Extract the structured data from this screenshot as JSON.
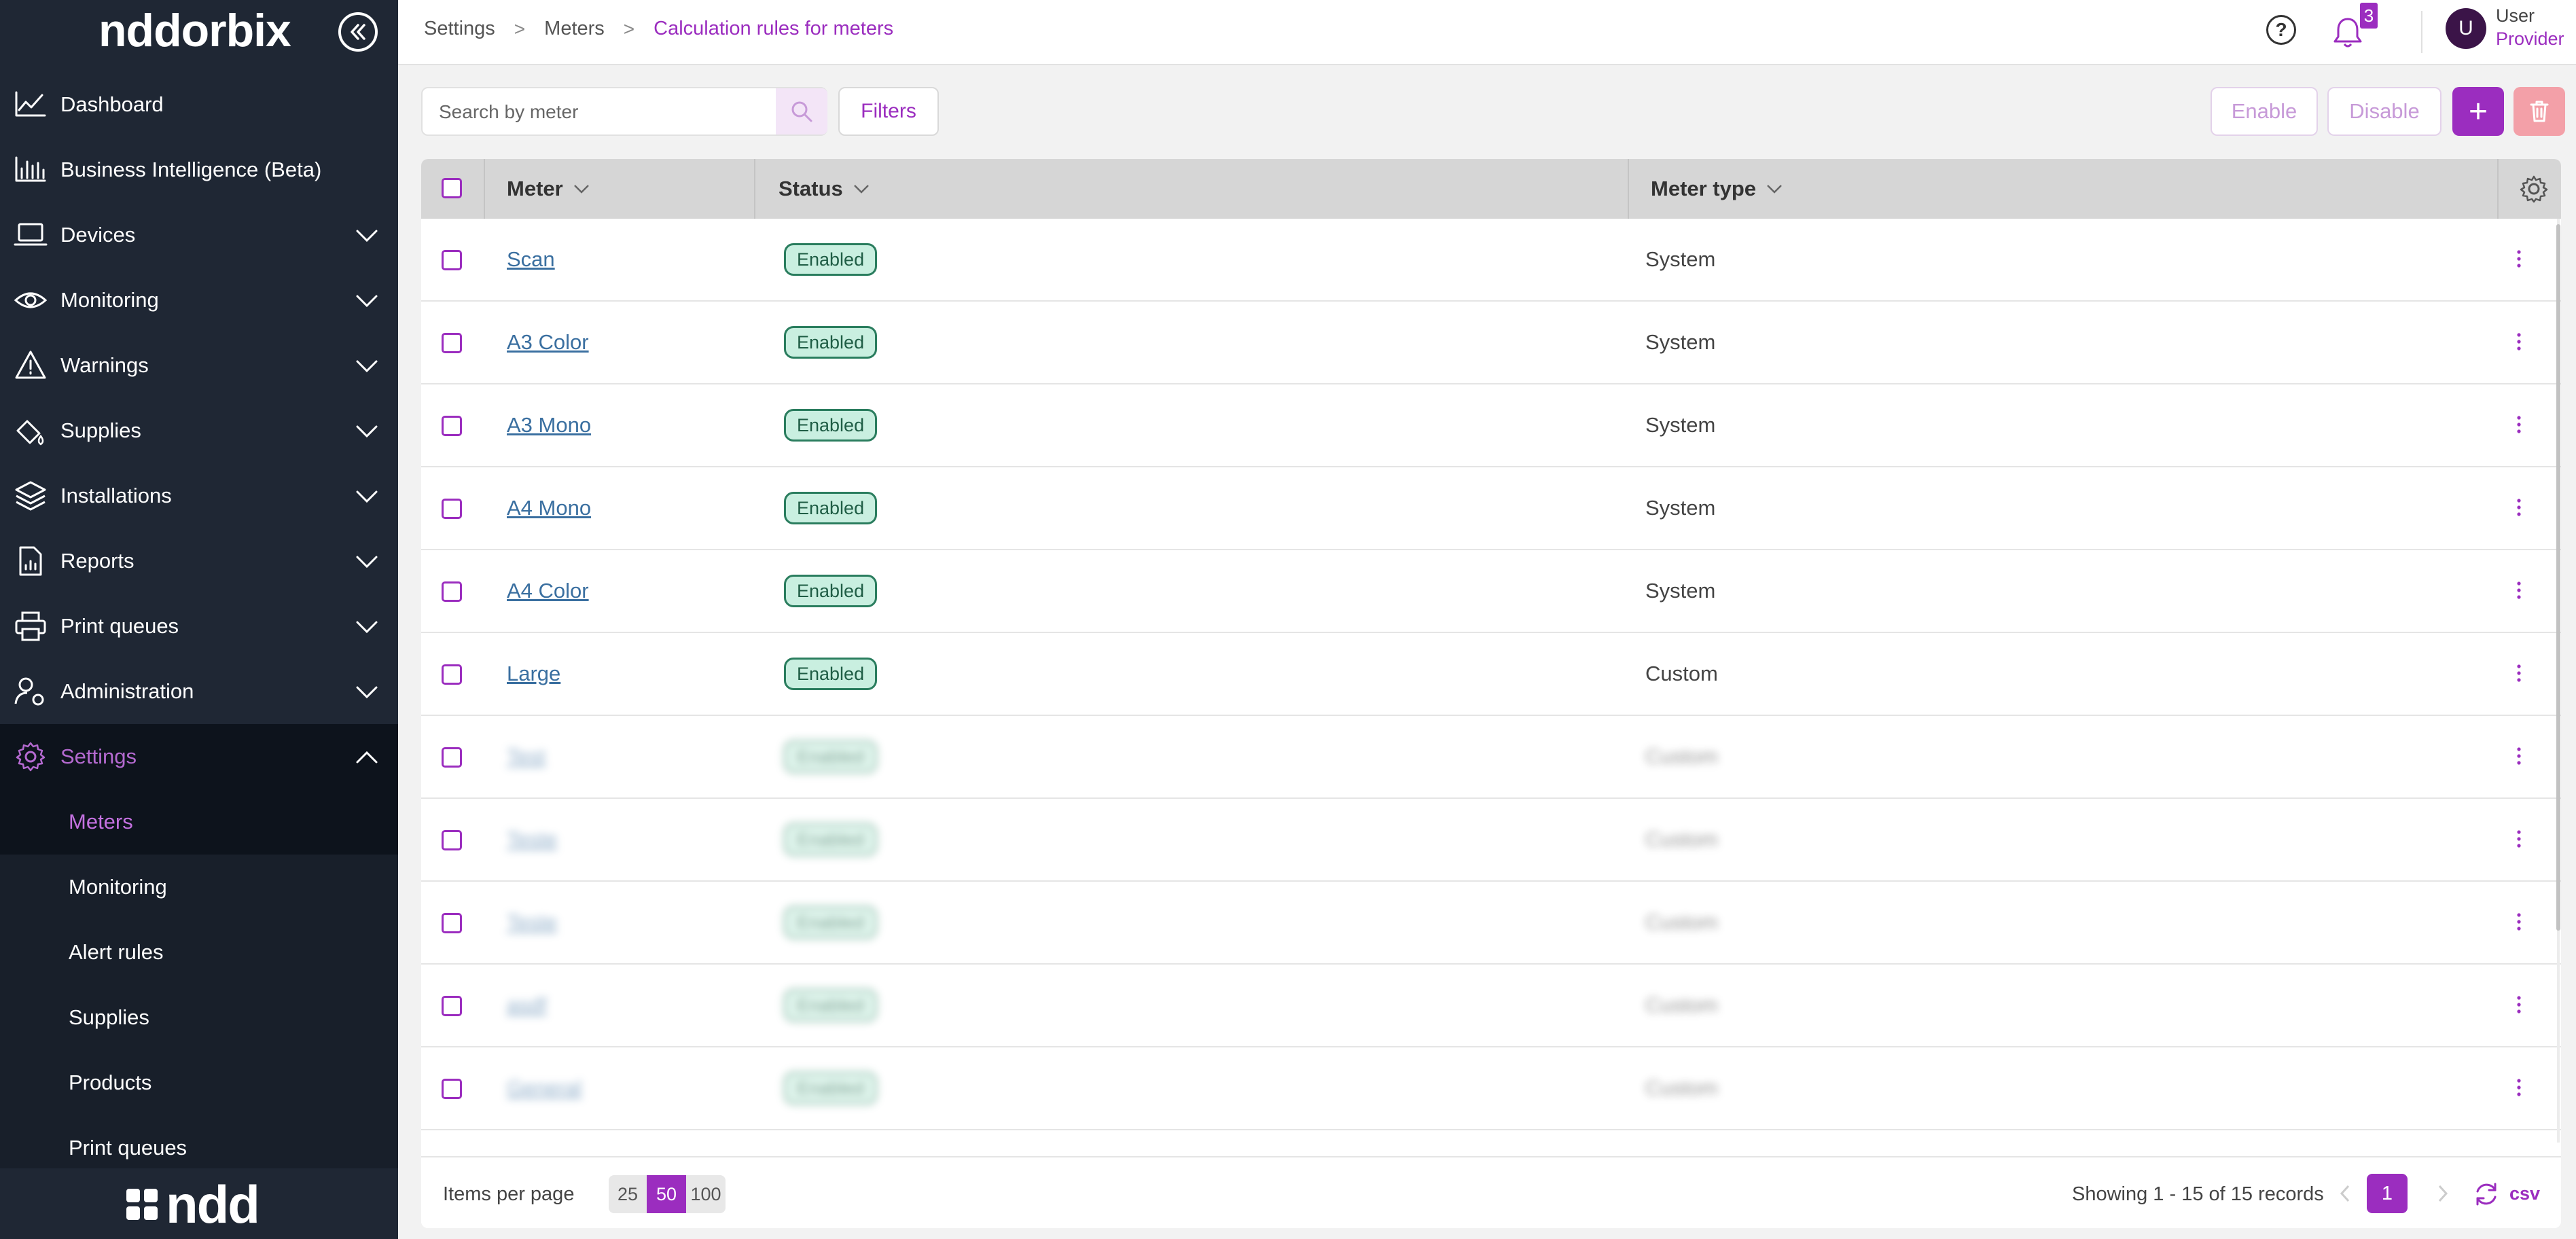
{
  "app": {
    "logo": "nddorbix",
    "footer_logo": "ndd"
  },
  "sidebar": {
    "items": [
      {
        "label": "Dashboard",
        "icon": "chart-line-icon",
        "expandable": false
      },
      {
        "label": "Business Intelligence (Beta)",
        "icon": "bar-chart-icon",
        "expandable": false
      },
      {
        "label": "Devices",
        "icon": "laptop-icon",
        "expandable": true
      },
      {
        "label": "Monitoring",
        "icon": "eye-icon",
        "expandable": true
      },
      {
        "label": "Warnings",
        "icon": "warning-icon",
        "expandable": true
      },
      {
        "label": "Supplies",
        "icon": "supplies-icon",
        "expandable": true
      },
      {
        "label": "Installations",
        "icon": "layers-icon",
        "expandable": true
      },
      {
        "label": "Reports",
        "icon": "report-icon",
        "expandable": true
      },
      {
        "label": "Print queues",
        "icon": "printer-icon",
        "expandable": true
      },
      {
        "label": "Administration",
        "icon": "user-gear-icon",
        "expandable": true
      },
      {
        "label": "Settings",
        "icon": "gear-icon",
        "expandable": true,
        "expanded": true,
        "active": true
      }
    ],
    "settings_sub": [
      {
        "label": "Meters",
        "active": true
      },
      {
        "label": "Monitoring"
      },
      {
        "label": "Alert rules"
      },
      {
        "label": "Supplies"
      },
      {
        "label": "Products"
      },
      {
        "label": "Print queues"
      }
    ]
  },
  "header": {
    "breadcrumb": [
      "Settings",
      "Meters",
      "Calculation rules for meters"
    ],
    "notifications_count": "3",
    "user": {
      "initial": "U",
      "name": "User",
      "role": "Provider"
    }
  },
  "toolbar": {
    "search_placeholder": "Search by meter",
    "filters_label": "Filters",
    "enable_label": "Enable",
    "disable_label": "Disable",
    "add_label": "+"
  },
  "table": {
    "columns": [
      "Meter",
      "Status",
      "Meter type"
    ],
    "rows": [
      {
        "meter": "Scan",
        "status": "Enabled",
        "type": "System",
        "blurred": false
      },
      {
        "meter": "A3 Color",
        "status": "Enabled",
        "type": "System",
        "blurred": false
      },
      {
        "meter": "A3 Mono",
        "status": "Enabled",
        "type": "System",
        "blurred": false
      },
      {
        "meter": "A4 Mono",
        "status": "Enabled",
        "type": "System",
        "blurred": false
      },
      {
        "meter": "A4 Color",
        "status": "Enabled",
        "type": "System",
        "blurred": false
      },
      {
        "meter": "Large",
        "status": "Enabled",
        "type": "Custom",
        "blurred": false
      },
      {
        "meter": "Test",
        "status": "Enabled",
        "type": "Custom",
        "blurred": true
      },
      {
        "meter": "Teste",
        "status": "Enabled",
        "type": "Custom",
        "blurred": true
      },
      {
        "meter": "Teste",
        "status": "Enabled",
        "type": "Custom",
        "blurred": true
      },
      {
        "meter": "asdf",
        "status": "Enabled",
        "type": "Custom",
        "blurred": true
      },
      {
        "meter": "General",
        "status": "Enabled",
        "type": "Custom",
        "blurred": true
      }
    ]
  },
  "footer": {
    "items_per_page_label": "Items per page",
    "page_sizes": [
      "25",
      "50",
      "100"
    ],
    "selected_page_size": "50",
    "showing_text": "Showing  1 - 15 of 15 records",
    "current_page": "1",
    "csv_label": "csv"
  },
  "colors": {
    "accent": "#9b2dbf",
    "sidebar_bg": "#1f2734",
    "status_bg": "#c9efe0",
    "status_border": "#2a7d5e"
  }
}
